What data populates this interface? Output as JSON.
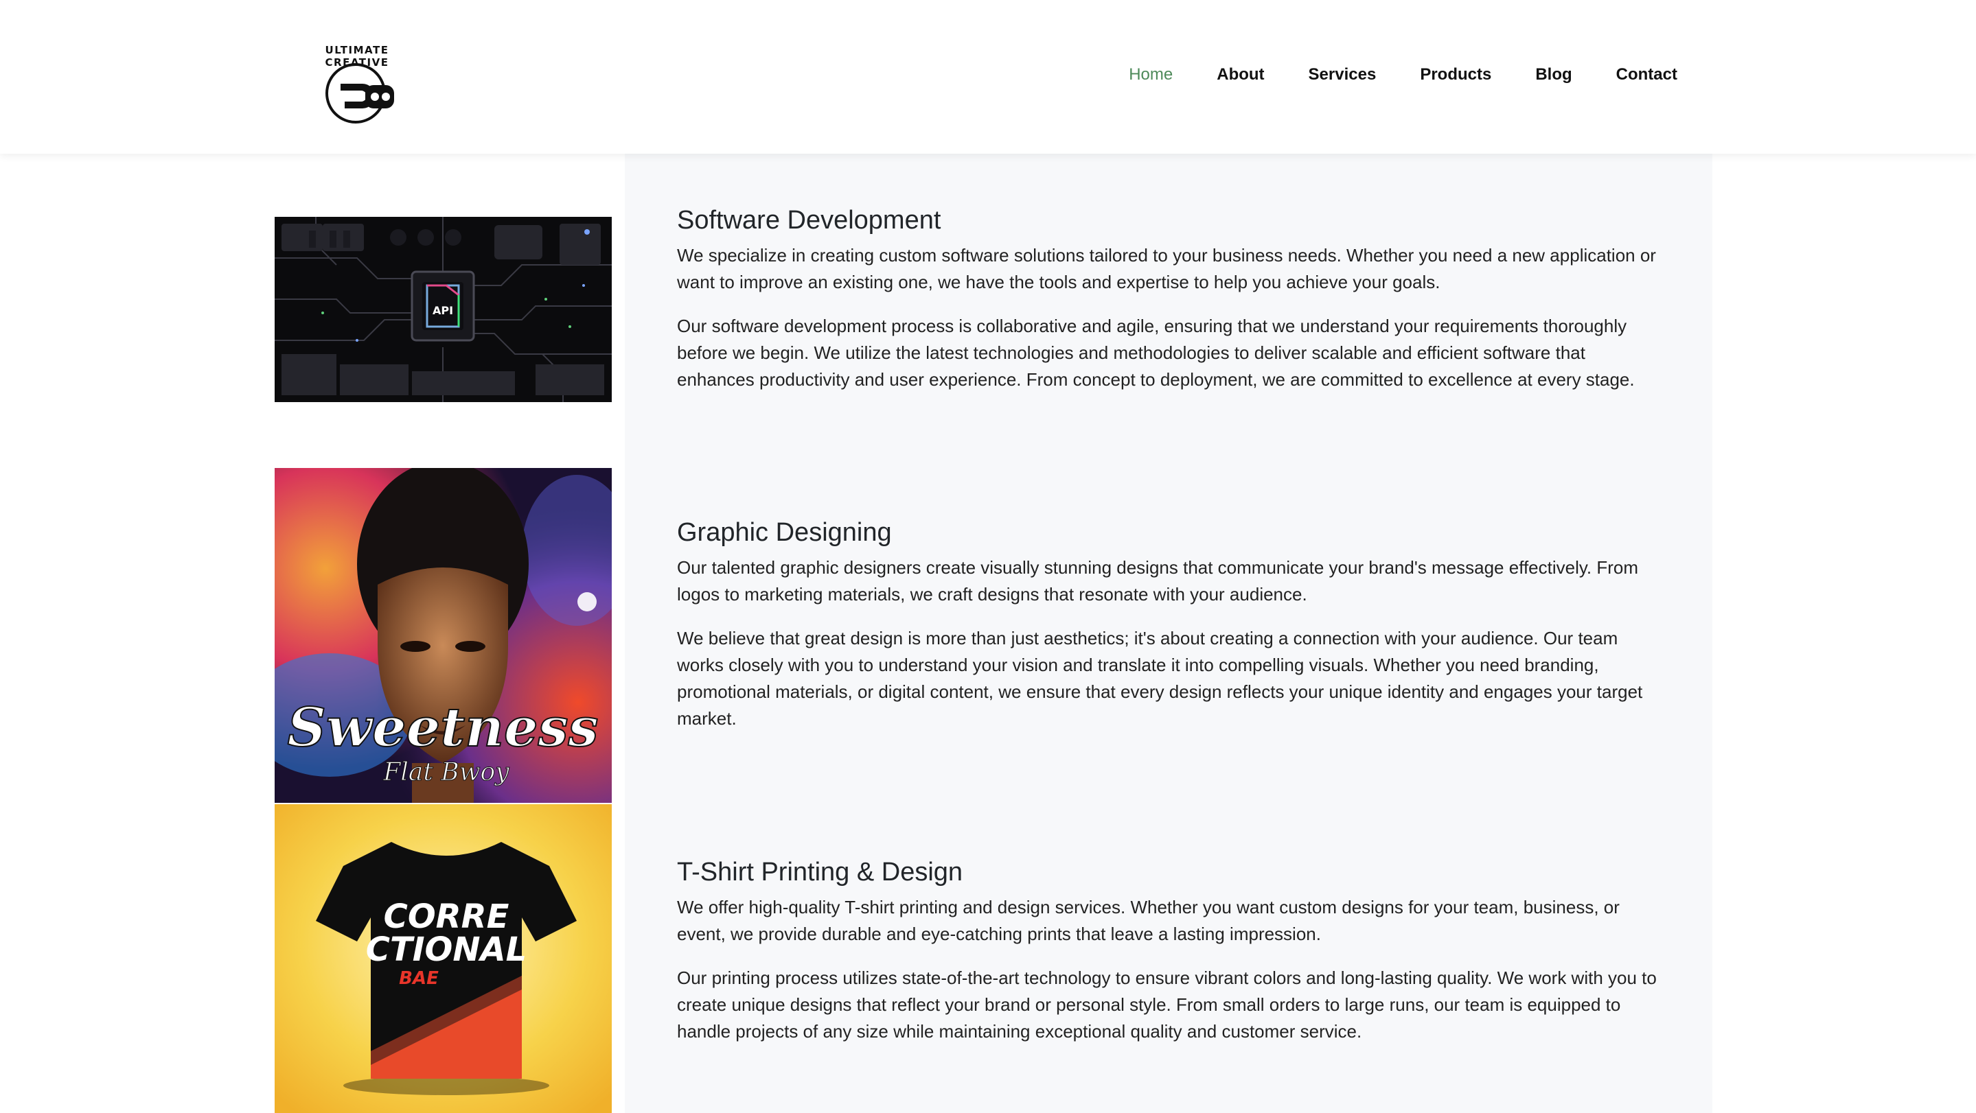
{
  "header": {
    "logo_text": "ULTIMATE CREATIVE",
    "nav": [
      {
        "label": "Home",
        "active": true
      },
      {
        "label": "About"
      },
      {
        "label": "Services"
      },
      {
        "label": "Products"
      },
      {
        "label": "Blog"
      },
      {
        "label": "Contact"
      }
    ]
  },
  "colors": {
    "accent": "#4e8a5a",
    "panel_bg": "#f7f8fa",
    "text": "#212529"
  },
  "services": [
    {
      "title": "Software Development",
      "image_caption": "API",
      "paragraphs": [
        "We specialize in creating custom software solutions tailored to your business needs. Whether you need a new application or want to improve an existing one, we have the tools and expertise to help you achieve your goals.",
        "Our software development process is collaborative and agile, ensuring that we understand your requirements thoroughly before we begin. We utilize the latest technologies and methodologies to deliver scalable and efficient software that enhances productivity and user experience. From concept to deployment, we are committed to excellence at every stage."
      ]
    },
    {
      "title": "Graphic Designing",
      "image_caption": "Sweetness",
      "image_subcaption": "Flat Bwoy",
      "paragraphs": [
        "Our talented graphic designers create visually stunning designs that communicate your brand's message effectively. From logos to marketing materials, we craft designs that resonate with your audience.",
        "We believe that great design is more than just aesthetics; it's about creating a connection with your audience. Our team works closely with you to understand your vision and translate it into compelling visuals. Whether you need branding, promotional materials, or digital content, we ensure that every design reflects your unique identity and engages your target market."
      ]
    },
    {
      "title": "T-Shirt Printing & Design",
      "image_caption_lines": [
        "CORRE",
        "CTIONAL"
      ],
      "image_subcaption": "BAE",
      "paragraphs": [
        "We offer high-quality T-shirt printing and design services. Whether you want custom designs for your team, business, or event, we provide durable and eye-catching prints that leave a lasting impression.",
        "Our printing process utilizes state-of-the-art technology to ensure vibrant colors and long-lasting quality. We work with you to create unique designs that reflect your brand or personal style. From small orders to large runs, our team is equipped to handle projects of any size while maintaining exceptional quality and customer service."
      ]
    }
  ]
}
